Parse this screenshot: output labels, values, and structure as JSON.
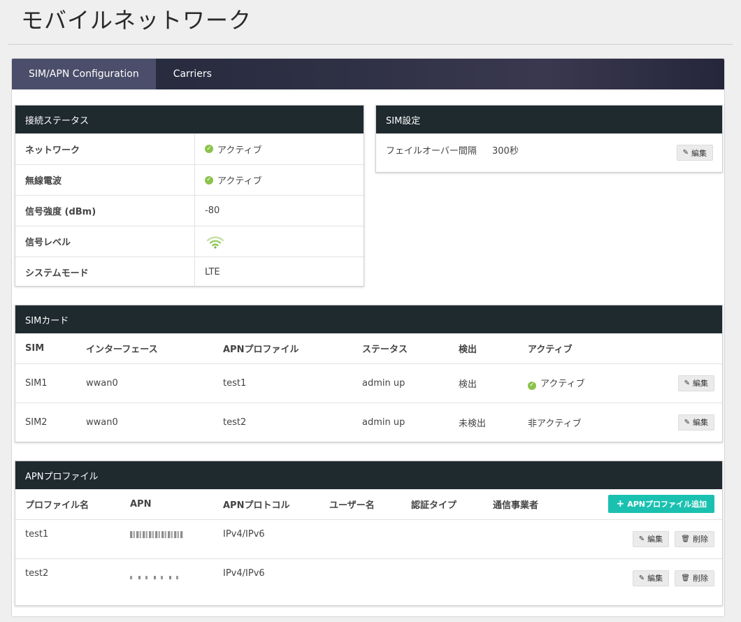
{
  "page": {
    "title": "モバイルネットワーク"
  },
  "tabs": [
    {
      "label": "SIM/APN Configuration",
      "active": true
    },
    {
      "label": "Carriers",
      "active": false
    }
  ],
  "connection_status": {
    "title": "接続ステータス",
    "rows": [
      {
        "label": "ネットワーク",
        "value": "アクティブ",
        "icon": "check-circle-icon"
      },
      {
        "label": "無線電波",
        "value": "アクティブ",
        "icon": "check-circle-icon"
      },
      {
        "label": "信号強度 (dBm)",
        "value": "-80"
      },
      {
        "label": "信号レベル",
        "icon": "wifi-signal-icon"
      },
      {
        "label": "システムモード",
        "value": "LTE"
      }
    ]
  },
  "sim_settings": {
    "title": "SIM設定",
    "failover_label": "フェイルオーバー間隔",
    "failover_value": "300秒",
    "edit_label": "編集"
  },
  "sim_cards": {
    "title": "SIMカード",
    "columns": [
      "SIM",
      "インターフェース",
      "APNプロファイル",
      "ステータス",
      "検出",
      "アクティブ"
    ],
    "rows": [
      {
        "sim": "SIM1",
        "interface": "wwan0",
        "apn_profile": "test1",
        "status": "admin up",
        "detect": "検出",
        "active": "アクティブ",
        "active_icon": "check-circle-icon",
        "edit": "編集"
      },
      {
        "sim": "SIM2",
        "interface": "wwan0",
        "apn_profile": "test2",
        "status": "admin up",
        "detect": "未検出",
        "active": "非アクティブ",
        "edit": "編集"
      }
    ]
  },
  "apn_profiles": {
    "title": "APNプロファイル",
    "add_label": "APNプロファイル追加",
    "columns": [
      "プロファイル名",
      "APN",
      "APNプロトコル",
      "ユーザー名",
      "認証タイプ",
      "通信事業者"
    ],
    "rows": [
      {
        "name": "test1",
        "protocol": "IPv4/IPv6",
        "edit": "編集",
        "delete": "削除"
      },
      {
        "name": "test2",
        "protocol": "IPv4/IPv6",
        "edit": "編集",
        "delete": "削除"
      }
    ]
  },
  "colors": {
    "panel_header": "#1f2a2f",
    "accent_teal": "#1bc1b0",
    "active_green": "#8bc34a",
    "tab_active": "#4a4e6a"
  }
}
